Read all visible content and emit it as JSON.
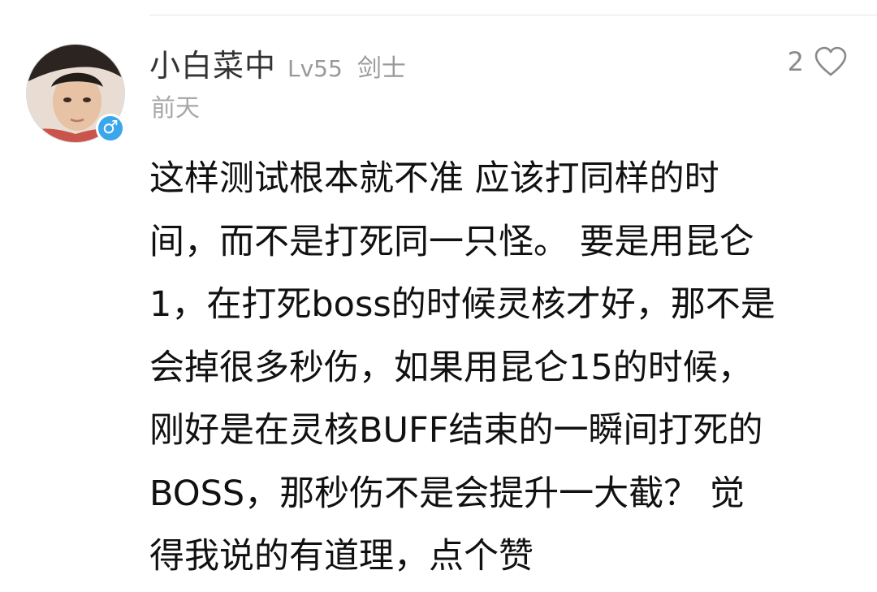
{
  "comment": {
    "user": {
      "name": "小白菜中",
      "level": "Lv55",
      "class": "剑士",
      "gender_symbol": "♂",
      "gender_icon": "male-icon",
      "badge_color": "#3aa6ec"
    },
    "timestamp": "前天",
    "likes": {
      "count": "2",
      "icon": "heart-outline-icon"
    },
    "body_lines": [
      "这样测试根本就不准  应该打同样的时",
      "间，而不是打死同一只怪。  要是用昆仑",
      "1，在打死boss的时候灵核才好，那不是",
      "会掉很多秒伤，如果用昆仑15的时候，",
      "刚好是在灵核BUFF结束的一瞬间打死的",
      "BOSS，那秒伤不是会提升一大截？  觉",
      "得我说的有道理，点个赞"
    ]
  }
}
